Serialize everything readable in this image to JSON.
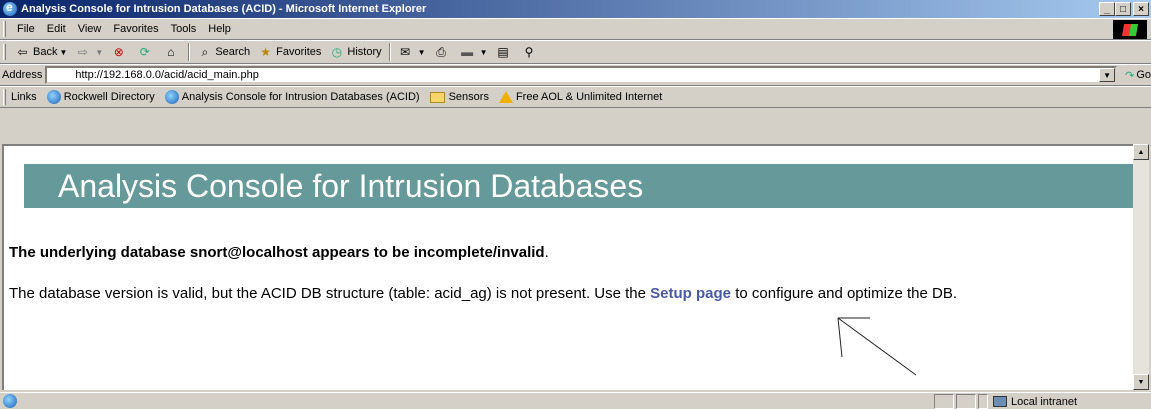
{
  "window": {
    "title": "Analysis Console for Intrusion Databases (ACID) - Microsoft Internet Explorer",
    "controls": [
      "_",
      "□",
      "×"
    ]
  },
  "menu": [
    "File",
    "Edit",
    "View",
    "Favorites",
    "Tools",
    "Help"
  ],
  "toolbar": {
    "back": "Back",
    "search": "Search",
    "favorites": "Favorites",
    "history": "History"
  },
  "address": {
    "label": "Address",
    "url": "http://192.168.0.0/acid/acid_main.php",
    "go": "Go"
  },
  "links": {
    "label": "Links",
    "items": [
      "Rockwell Directory",
      "Analysis Console for Intrusion Databases (ACID)",
      "Sensors",
      "Free AOL & Unlimited Internet"
    ]
  },
  "page": {
    "banner_title": "Analysis Console for Intrusion Databases",
    "error_heading": "The underlying database snort@localhost appears to be incomplete/invalid",
    "error_heading_tail": ".",
    "message_prefix": "The database version is valid, but the ACID DB structure (table: acid_ag) is not present. Use the",
    "setup_link": "Setup page",
    "message_suffix": "to configure and optimize the DB."
  },
  "status": {
    "zone": "Local intranet"
  }
}
